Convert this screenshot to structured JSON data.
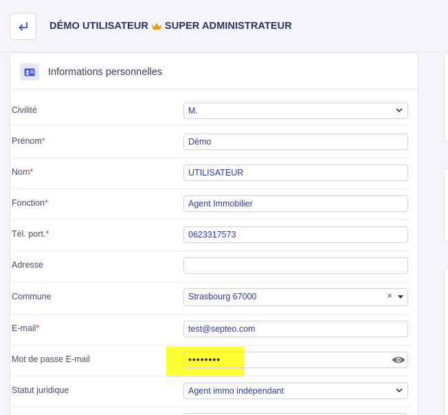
{
  "header": {
    "back_icon": "return-arrow-icon",
    "user_name": "DÉMO UTILISATEUR",
    "crown_icon": "crown-icon",
    "role": "SUPER ADMINISTRATEUR"
  },
  "card": {
    "icon": "id-card-icon",
    "title": "Informations personnelles"
  },
  "form": {
    "civilite": {
      "label": "Civilité",
      "value": "M."
    },
    "prenom": {
      "label": "Prénom",
      "required": "*",
      "value": "Démo"
    },
    "nom": {
      "label": "Nom",
      "required": "*",
      "value": "UTILISATEUR"
    },
    "fonction": {
      "label": "Fonction",
      "required": "*",
      "value": "Agent Immobilier"
    },
    "tel": {
      "label": "Tél. port.",
      "required": "*",
      "value": "0623317573"
    },
    "adresse": {
      "label": "Adresse",
      "value": ""
    },
    "commune": {
      "label": "Commune",
      "value": "Strasbourg 67000",
      "clear": "×"
    },
    "email": {
      "label": "E-mail",
      "required": "*",
      "value": "test@septeo.com"
    },
    "password": {
      "label": "Mot de passe E-mail",
      "value": "••••••••",
      "toggle_icon": "eye-icon"
    },
    "statut": {
      "label": "Statut juridique",
      "value": "Agent immo indépendant"
    }
  },
  "colors": {
    "accent": "#4a5bd3",
    "title": "#2d2f5e",
    "field_text": "#2d3aa0",
    "required": "#d23a3a",
    "highlight": "#ffff33",
    "crown": "#e7a21b"
  }
}
